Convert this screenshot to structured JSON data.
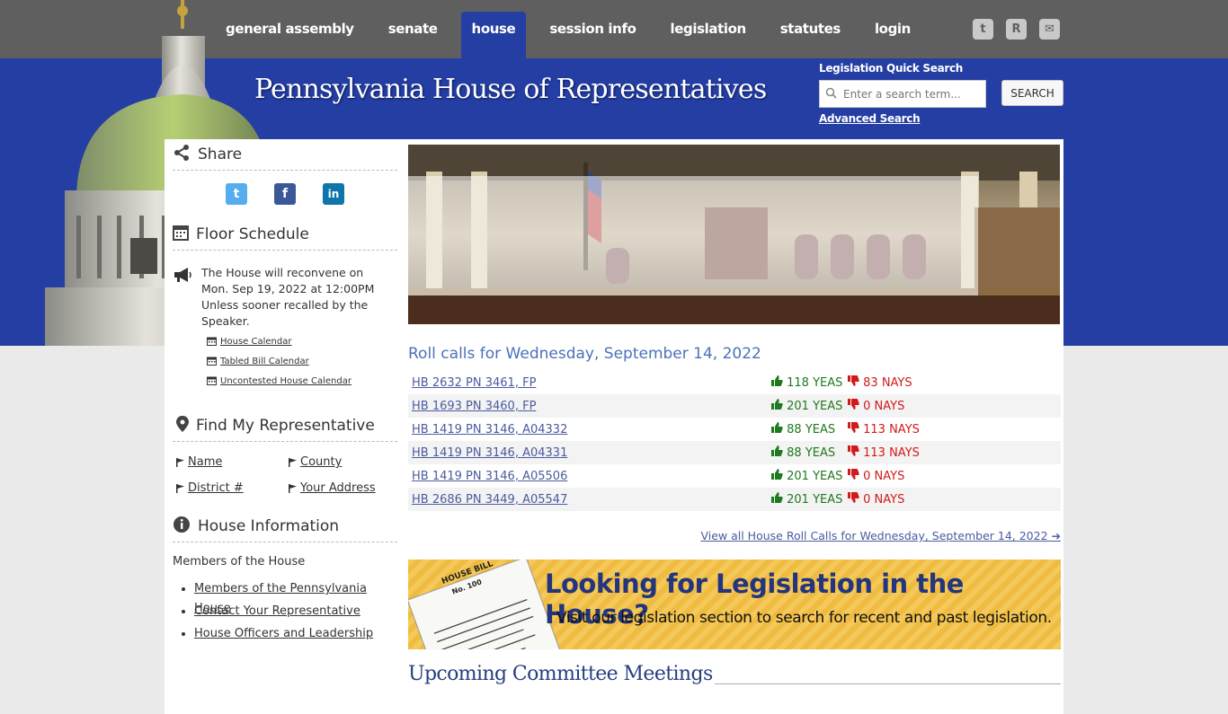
{
  "nav": [
    "general assembly",
    "senate",
    "house",
    "session info",
    "legislation",
    "statutes",
    "login"
  ],
  "nav_active": "house",
  "social_top": [
    {
      "icon": "twitter-icon",
      "glyph": "t"
    },
    {
      "icon": "rss-icon",
      "glyph": "R"
    },
    {
      "icon": "mail-icon",
      "glyph": "✉"
    }
  ],
  "header": {
    "title": "Pennsylvania House of Representatives"
  },
  "search": {
    "label": "Legislation Quick Search",
    "placeholder": "Enter a search term...",
    "button": "SEARCH",
    "advanced": "Advanced Search"
  },
  "sidebar": {
    "share": {
      "title": "Share"
    },
    "floor": {
      "title": "Floor Schedule",
      "line1": "The House will reconvene on",
      "line2": "Mon. Sep 19, 2022 at 12:00PM",
      "line3": "Unless sooner recalled by the Speaker.",
      "links": [
        "House Calendar",
        "Tabled Bill Calendar",
        "Uncontested House Calendar"
      ]
    },
    "rep": {
      "title": "Find My Representative",
      "links": [
        "Name",
        "County",
        "District #",
        "Your Address"
      ]
    },
    "info": {
      "title": "House Information",
      "subtitle": "Members of the House",
      "links": [
        "Members of the Pennsylvania House",
        "Contact Your Representative",
        "House Officers and Leadership"
      ]
    }
  },
  "rollcalls": {
    "title": "Roll calls for Wednesday, September 14, 2022",
    "rows": [
      {
        "bill": "HB 2632 PN 3461, FP",
        "yeas": "118 YEAS",
        "nays": "83 NAYS"
      },
      {
        "bill": "HB 1693 PN 3460, FP",
        "yeas": "201 YEAS",
        "nays": "0 NAYS"
      },
      {
        "bill": "HB 1419 PN 3146, A04332",
        "yeas": "88 YEAS",
        "nays": "113 NAYS"
      },
      {
        "bill": "HB 1419 PN 3146, A04331",
        "yeas": "88 YEAS",
        "nays": "113 NAYS"
      },
      {
        "bill": "HB 1419 PN 3146, A05506",
        "yeas": "201 YEAS",
        "nays": "0 NAYS"
      },
      {
        "bill": "HB 2686 PN 3449, A05547",
        "yeas": "201 YEAS",
        "nays": "0 NAYS"
      }
    ],
    "view_all": "View all House Roll Calls for Wednesday, September 14, 2022"
  },
  "promo": {
    "headline": "Looking for Legislation in the House?",
    "sub": "Visit our legislation section to search for recent and past legislation.",
    "doc_label": "HOUSE BILL",
    "doc_no": "No. 100"
  },
  "committee": {
    "title": "Upcoming Committee Meetings"
  },
  "colors": {
    "blue": "#243ea3",
    "nav_gray": "#5f5f5f",
    "yea": "#1e7a1e",
    "nay": "#d21a1a",
    "link": "#4b5b9e"
  }
}
